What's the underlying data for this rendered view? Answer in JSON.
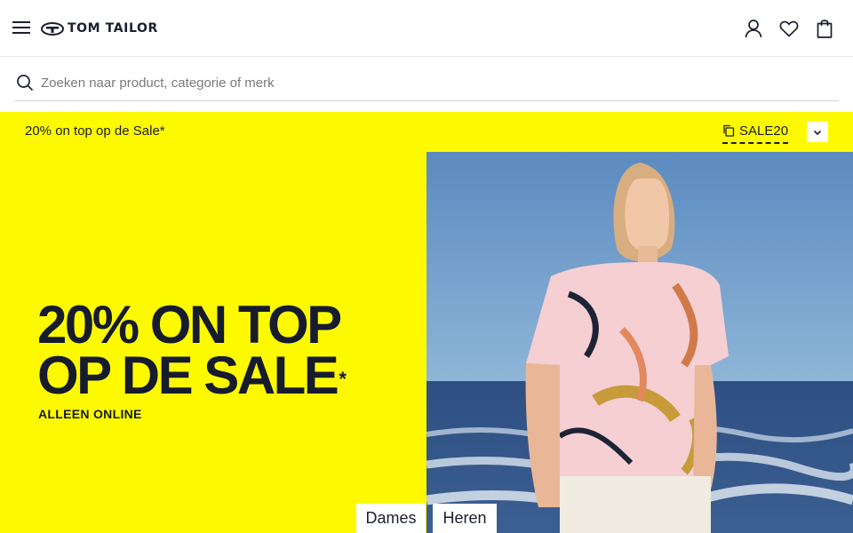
{
  "header": {
    "menu_icon": "hamburger-menu-icon",
    "logo_text": "TOM TAILOR",
    "account_icon": "user-icon",
    "wishlist_icon": "heart-icon",
    "cart_icon": "shopping-bag-icon"
  },
  "search": {
    "icon": "search-icon",
    "placeholder": "Zoeken naar product, categorie of merk",
    "value": ""
  },
  "promo_bar": {
    "text": "20% on top op de Sale*",
    "code_icon": "copy-icon",
    "code": "SALE20",
    "toggle_icon": "chevron-down-icon",
    "background": "#fdfa00"
  },
  "hero": {
    "headline_line1": "20% ON TOP",
    "headline_line2": "OP DE SALE",
    "headline_mark": "*",
    "subline": "ALLEEN ONLINE",
    "buttons": [
      {
        "label": "Dames"
      },
      {
        "label": "Heren"
      }
    ],
    "background": "#fdfa00",
    "text_color": "#161b2e"
  }
}
